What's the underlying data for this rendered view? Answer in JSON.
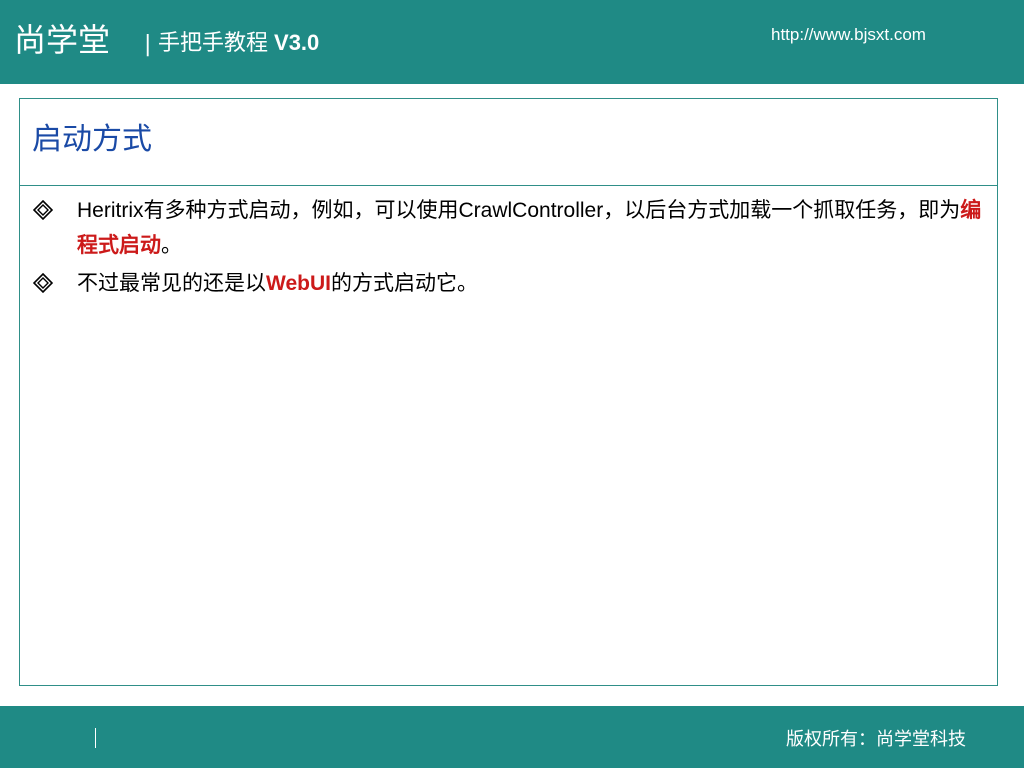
{
  "header": {
    "brand": "尚学堂",
    "separator": "|",
    "subtitle": "手把手教程",
    "version": "V3.0",
    "url": "http://www.bjsxt.com",
    "background_color": "#1f8a85"
  },
  "slide": {
    "title": "启动方式",
    "title_color": "#1a4aa6",
    "bullet_icon": "diamond-bullet-icon",
    "bullets": [
      {
        "parts": [
          {
            "text": "Heritrix",
            "style": "latin"
          },
          {
            "text": "有多种方式启动，例如，可以使用",
            "style": "normal"
          },
          {
            "text": "CrawlController",
            "style": "latin"
          },
          {
            "text": "，以后台方式加载一个抓取任务，即为",
            "style": "normal"
          },
          {
            "text": "编程式启动",
            "style": "highlight"
          },
          {
            "text": "。",
            "style": "normal"
          }
        ]
      },
      {
        "parts": [
          {
            "text": "不过最常见的还是以",
            "style": "normal"
          },
          {
            "text": "WebUI",
            "style": "highlight"
          },
          {
            "text": "的方式启动它。",
            "style": "normal"
          }
        ]
      }
    ],
    "highlight_color": "#cc1a1a"
  },
  "footer": {
    "divider": "|",
    "copyright": "版权所有：尚学堂科技"
  }
}
